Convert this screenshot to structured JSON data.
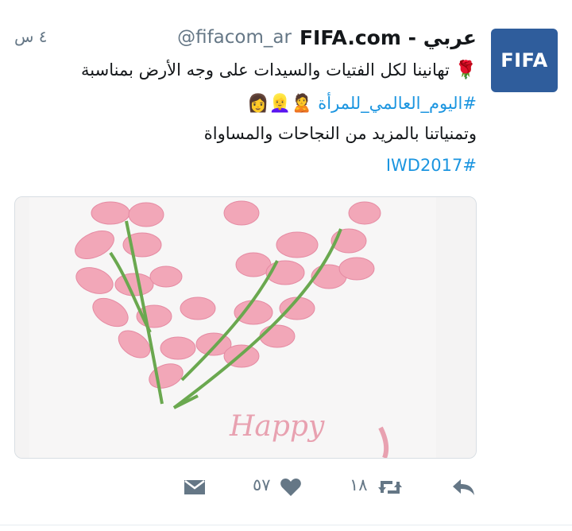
{
  "tweet": {
    "display_name": "FIFA.com - عربي",
    "handle": "@fifacom_ar",
    "timestamp": "٤ س",
    "avatar_text": "FIFA",
    "line1": "تهانينا لكل الفتيات والسيدات على وجه الأرض بمناسبة",
    "line1_emoji": "🌹",
    "line2_hashtag": "#اليوم_العالمي_للمرأة",
    "line2_emojis": "🙎👱‍♀️👩",
    "line3": "وتمنياتنا بالمزيد من النجاحات والمساواة",
    "line4_hashtag": "#IWD2017",
    "media_text": "Happy",
    "retweet_count": "١٨",
    "like_count": "٥٧"
  },
  "colors": {
    "link": "#1b95e0",
    "muted": "#657786",
    "avatar_bg": "#2f5d9c",
    "tulip": "#f2a7b8",
    "stem": "#6aa84f"
  },
  "icons": [
    "reply-icon",
    "retweet-icon",
    "like-icon",
    "direct-message-icon"
  ]
}
